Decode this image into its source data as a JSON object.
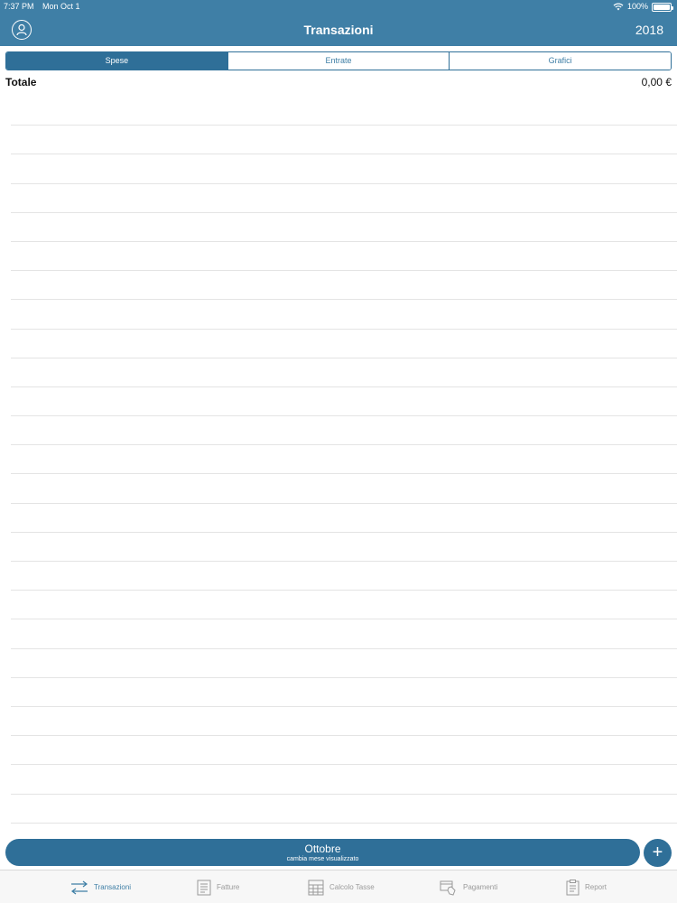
{
  "status_bar": {
    "time": "7:37 PM",
    "date": "Mon Oct 1",
    "battery": "100%"
  },
  "nav": {
    "title": "Transazioni",
    "year": "2018"
  },
  "segments": [
    {
      "label": "Spese",
      "active": true
    },
    {
      "label": "Entrate",
      "active": false
    },
    {
      "label": "Grafici",
      "active": false
    }
  ],
  "totals": {
    "label": "Totale",
    "value": "0,00 €"
  },
  "month_selector": {
    "month": "Ottobre",
    "subtitle": "cambia mese visualizzato"
  },
  "tabs": [
    {
      "label": "Transazioni",
      "icon": "transfer-arrows-icon",
      "active": true
    },
    {
      "label": "Fatture",
      "icon": "invoice-icon",
      "active": false
    },
    {
      "label": "Calcolo Tasse",
      "icon": "calculator-icon",
      "active": false
    },
    {
      "label": "Pagamenti",
      "icon": "payments-icon",
      "active": false
    },
    {
      "label": "Report",
      "icon": "clipboard-report-icon",
      "active": false
    }
  ],
  "colors": {
    "primary": "#3f7fa6",
    "primary_dark": "#2f6f98",
    "tab_inactive": "#9a9a9a"
  }
}
